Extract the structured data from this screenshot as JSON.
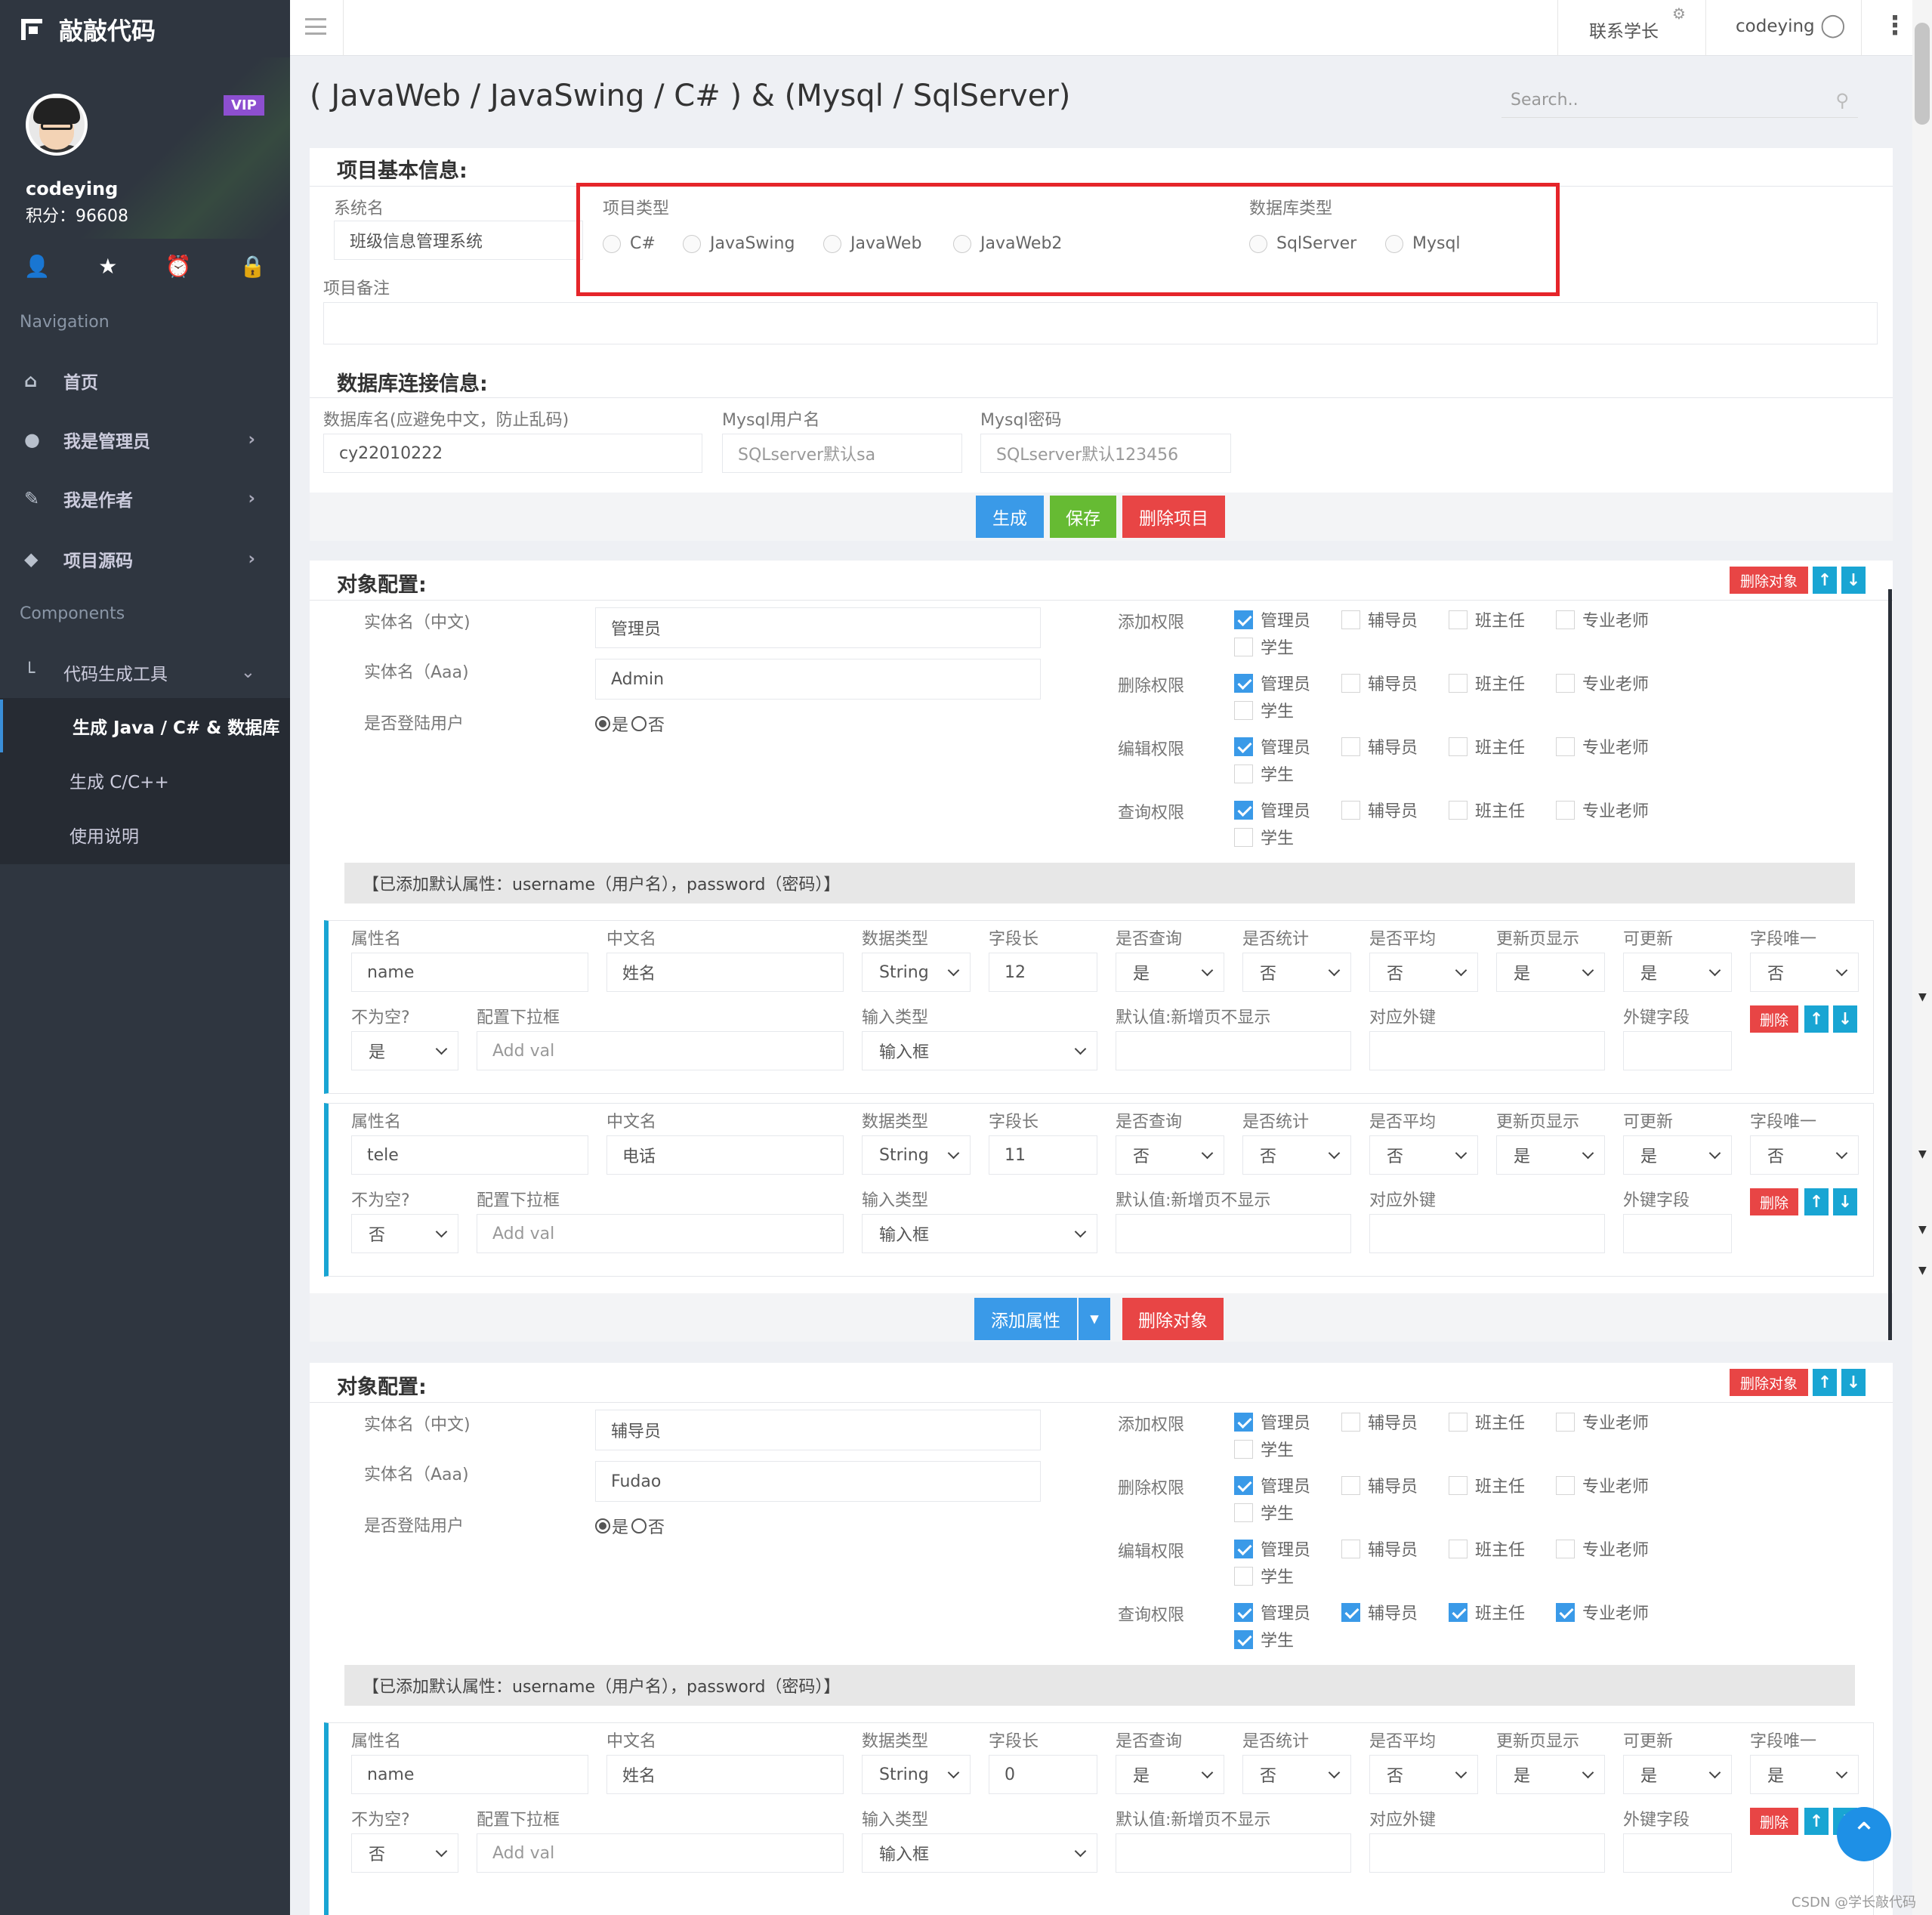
{
  "app": {
    "logo": "敲敲代码"
  },
  "profile": {
    "vip": "VIP",
    "name": "codeying",
    "score": "积分：96608"
  },
  "sidebar": {
    "nav_heading": "Navigation",
    "components_heading": "Components",
    "items": [
      {
        "label": "首页",
        "icon": "home-icon"
      },
      {
        "label": "我是管理员",
        "icon": "user-icon"
      },
      {
        "label": "我是作者",
        "icon": "pencil-icon"
      },
      {
        "label": "项目源码",
        "icon": "tag-icon"
      },
      {
        "label": "代码生成工具",
        "icon": "tool-icon"
      }
    ],
    "subitems": [
      "生成 Java / C# & 数据库",
      "生成 C/C++",
      "使用说明"
    ]
  },
  "topbar": {
    "contact": "联系学长",
    "user": "codeying"
  },
  "page": {
    "title": "( JavaWeb / JavaSwing / C# ) & (Mysql / SqlServer)",
    "search_placeholder": "Search.."
  },
  "basic": {
    "title": "项目基本信息:",
    "sysname_label": "系统名",
    "sysname_value": "班级信息管理系统",
    "project_type_label": "项目类型",
    "project_types": [
      "C#",
      "JavaSwing",
      "JavaWeb",
      "JavaWeb2"
    ],
    "db_type_label": "数据库类型",
    "db_types": [
      "SqlServer",
      "Mysql"
    ],
    "remark_label": "项目备注"
  },
  "db": {
    "title": "数据库连接信息:",
    "name_label": "数据库名(应避免中文，防止乱码)",
    "name_value": "cy22010222",
    "user_label": "Mysql用户名",
    "user_placeholder": "SQLserver默认sa",
    "pwd_label": "Mysql密码",
    "pwd_placeholder": "SQLserver默认123456",
    "btn_generate": "生成",
    "btn_save": "保存",
    "btn_delete": "删除项目"
  },
  "common": {
    "obj_title": "对象配置:",
    "del_obj": "删除对象",
    "up": "↑",
    "down": "↓",
    "cn_label": "实体名（中文)",
    "en_label": "实体名（Aaa)",
    "login_label": "是否登陆用户",
    "yes": "是",
    "no": "否",
    "perm_add": "添加权限",
    "perm_del": "删除权限",
    "perm_edit": "编辑权限",
    "perm_query": "查询权限",
    "roles": [
      "管理员",
      "辅导员",
      "班主任",
      "专业老师",
      "学生"
    ],
    "default_note": "【已添加默认属性：username（用户名），password（密码）】",
    "h_attr": "属性名",
    "h_cn": "中文名",
    "h_type": "数据类型",
    "h_len": "字段长",
    "h_q": "是否查询",
    "h_s": "是否统计",
    "h_a": "是否平均",
    "h_u": "更新页显示",
    "h_up": "可更新",
    "h_uni": "字段唯一",
    "h_nn": "不为空?",
    "h_dd": "配置下拉框",
    "h_input": "输入类型",
    "h_def": "默认值:新增页不显示",
    "h_fk": "对应外键",
    "h_fkf": "外键字段",
    "addval": "Add val",
    "del": "删除",
    "add_attr": "添加属性",
    "dropdown": "▾"
  },
  "objects": [
    {
      "cn": "管理员",
      "en": "Admin",
      "perms": {
        "add": [
          true,
          false,
          false,
          false,
          false
        ],
        "del": [
          true,
          false,
          false,
          false,
          false
        ],
        "edit": [
          true,
          false,
          false,
          false,
          false
        ],
        "query": [
          true,
          false,
          false,
          false,
          false
        ]
      },
      "attrs": [
        {
          "name": "name",
          "cn": "姓名",
          "type": "String",
          "len": "12",
          "q": "是",
          "s": "否",
          "a": "否",
          "u": "是",
          "up": "是",
          "uni": "否",
          "nn": "是",
          "input": "输入框"
        },
        {
          "name": "tele",
          "cn": "电话",
          "type": "String",
          "len": "11",
          "q": "否",
          "s": "否",
          "a": "否",
          "u": "是",
          "up": "是",
          "uni": "否",
          "nn": "否",
          "input": "输入框"
        }
      ]
    },
    {
      "cn": "辅导员",
      "en": "Fudao",
      "perms": {
        "add": [
          true,
          false,
          false,
          false,
          false
        ],
        "del": [
          true,
          false,
          false,
          false,
          false
        ],
        "edit": [
          true,
          false,
          false,
          false,
          false
        ],
        "query": [
          true,
          true,
          true,
          true,
          true
        ]
      },
      "attrs": [
        {
          "name": "name",
          "cn": "姓名",
          "type": "String",
          "len": "0",
          "q": "是",
          "s": "否",
          "a": "否",
          "u": "是",
          "up": "是",
          "uni": "是",
          "nn": "否",
          "input": "输入框"
        }
      ]
    }
  ],
  "watermark": "CSDN @学长敲代码"
}
